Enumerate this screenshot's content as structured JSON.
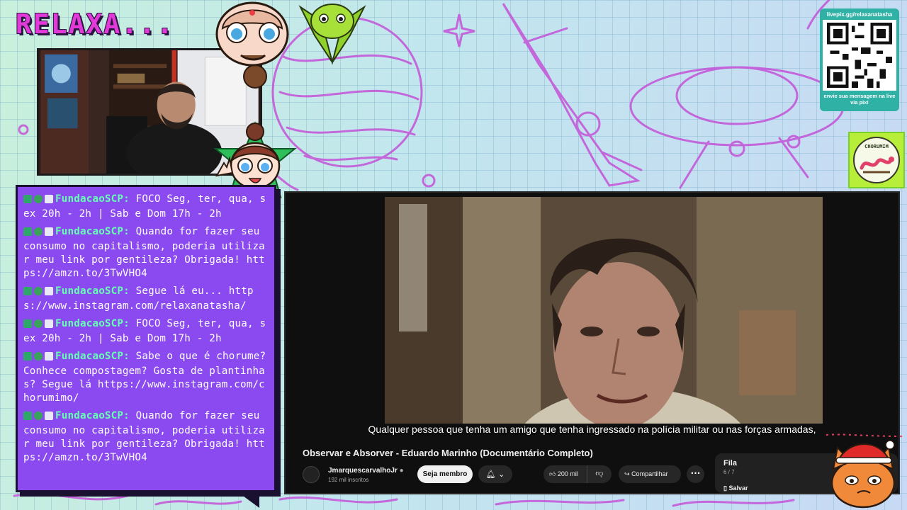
{
  "overlay": {
    "title": "RELAXA...",
    "qr": {
      "url": "livepix.gg/relaxanatasha",
      "caption": "envie sua mensagem na live via pix!"
    },
    "badge_text": "CHORUMIM"
  },
  "chat": {
    "messages": [
      {
        "user": "FundacaoSCP:",
        "text": "FOCO Seg, ter, qua, sex 20h - 2h | Sab e Dom 17h - 2h"
      },
      {
        "user": "FundacaoSCP:",
        "text": "Quando for fazer seu consumo no capitalismo, poderia utilizar meu link por gentileza? Obrigada! https://amzn.to/3TwVHO4"
      },
      {
        "user": "FundacaoSCP:",
        "text": "Segue lá eu... https://www.instagram.com/relaxanatasha/"
      },
      {
        "user": "FundacaoSCP:",
        "text": "FOCO Seg, ter, qua, sex 20h - 2h | Sab e Dom 17h - 2h"
      },
      {
        "user": "FundacaoSCP:",
        "text": "Sabe o que é chorume? Conhece compostagem? Gosta de plantinhas? Segue lá https://www.instagram.com/chorumimo/"
      },
      {
        "user": "FundacaoSCP:",
        "text": "Quando for fazer seu consumo no capitalismo, poderia utilizar meu link por gentileza? Obrigada! https://amzn.to/3TwVHO4"
      }
    ]
  },
  "video": {
    "subtitle": "Qualquer pessoa que tenha um amigo que tenha ingressado na polícia militar ou nas forças armadas,",
    "title": "Observar e Absorver - Eduardo Marinho (Documentário Completo)",
    "channel_name": "JmarquescarvalhoJr",
    "subscribers": "192 mil inscritos",
    "join_label": "Seja membro",
    "likes": "200 mil",
    "share_label": "Compartilhar",
    "more_label": "···",
    "queue_title": "Fila",
    "queue_count": "6 / 7",
    "save_label": "Salvar"
  },
  "colors": {
    "accent_pink": "#e23ad9",
    "chat_bg": "#8b4af0",
    "chat_user": "#66ffb2",
    "yt_bg": "#0f0f0f"
  }
}
